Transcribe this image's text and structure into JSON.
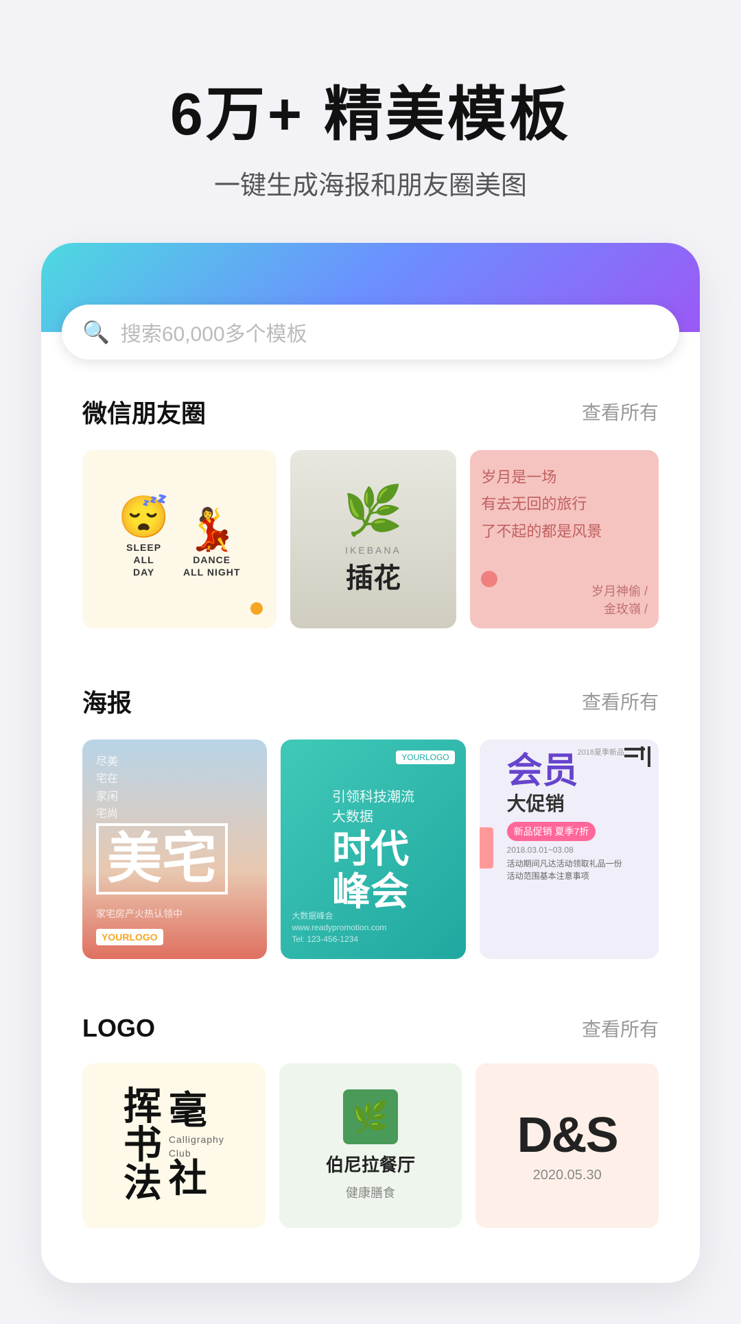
{
  "hero": {
    "title": "6万+ 精美模板",
    "subtitle": "一键生成海报和朋友圈美图"
  },
  "search": {
    "placeholder": "搜索60,000多个模板"
  },
  "sections": {
    "wechat": {
      "title": "微信朋友圈",
      "more": "查看所有"
    },
    "poster": {
      "title": "海报",
      "more": "查看所有"
    },
    "logo": {
      "title": "LOGO",
      "more": "查看所有"
    }
  },
  "wechat_cards": [
    {
      "id": "wc1",
      "type": "sleep-dance",
      "char1_label": "SLEEP\nALL\nDAY",
      "char2_label": "DANCE\nALL NIGHT"
    },
    {
      "id": "wc2",
      "type": "ikebana",
      "label_en": "IKEBANA",
      "label_zh": "插花"
    },
    {
      "id": "wc3",
      "type": "poem",
      "line1": "岁月是一场",
      "line2": "有去无回的旅行",
      "line3": "了不起的都是风景",
      "author1": "岁月神偷 /",
      "author2": "金玫嶺 /"
    }
  ],
  "poster_cards": [
    {
      "id": "p1",
      "title_zh": "美宅",
      "subtitle": "家宅房产火热认领中",
      "logo": "YOURLOGO"
    },
    {
      "id": "p2",
      "yourlogo": "YOURLOGO",
      "top_label": "引领科技潮流",
      "main_title": "时代峰会",
      "sub_label": "大数据",
      "bottom": "大数据"
    },
    {
      "id": "p3",
      "season": "2018夏季新品",
      "title1": "会员",
      "title2": "大促销",
      "badge": "新品促销 夏季7折",
      "date": "2018.03.01~03.08",
      "promo": "活动期间凡达活动领取礼品一份\n活动范围基本注意事项"
    }
  ],
  "logo_cards": [
    {
      "id": "l1",
      "zh_brush": "挥毫",
      "zh_calligraphy": "书法",
      "club_label": "Calligraphy Club",
      "she_label": "社"
    },
    {
      "id": "l2",
      "icon": "🌿",
      "name": "伯尼拉餐厅",
      "sub": "健康膳食"
    },
    {
      "id": "l3",
      "logo_text": "D&S",
      "date": "2020.05.30"
    }
  ]
}
